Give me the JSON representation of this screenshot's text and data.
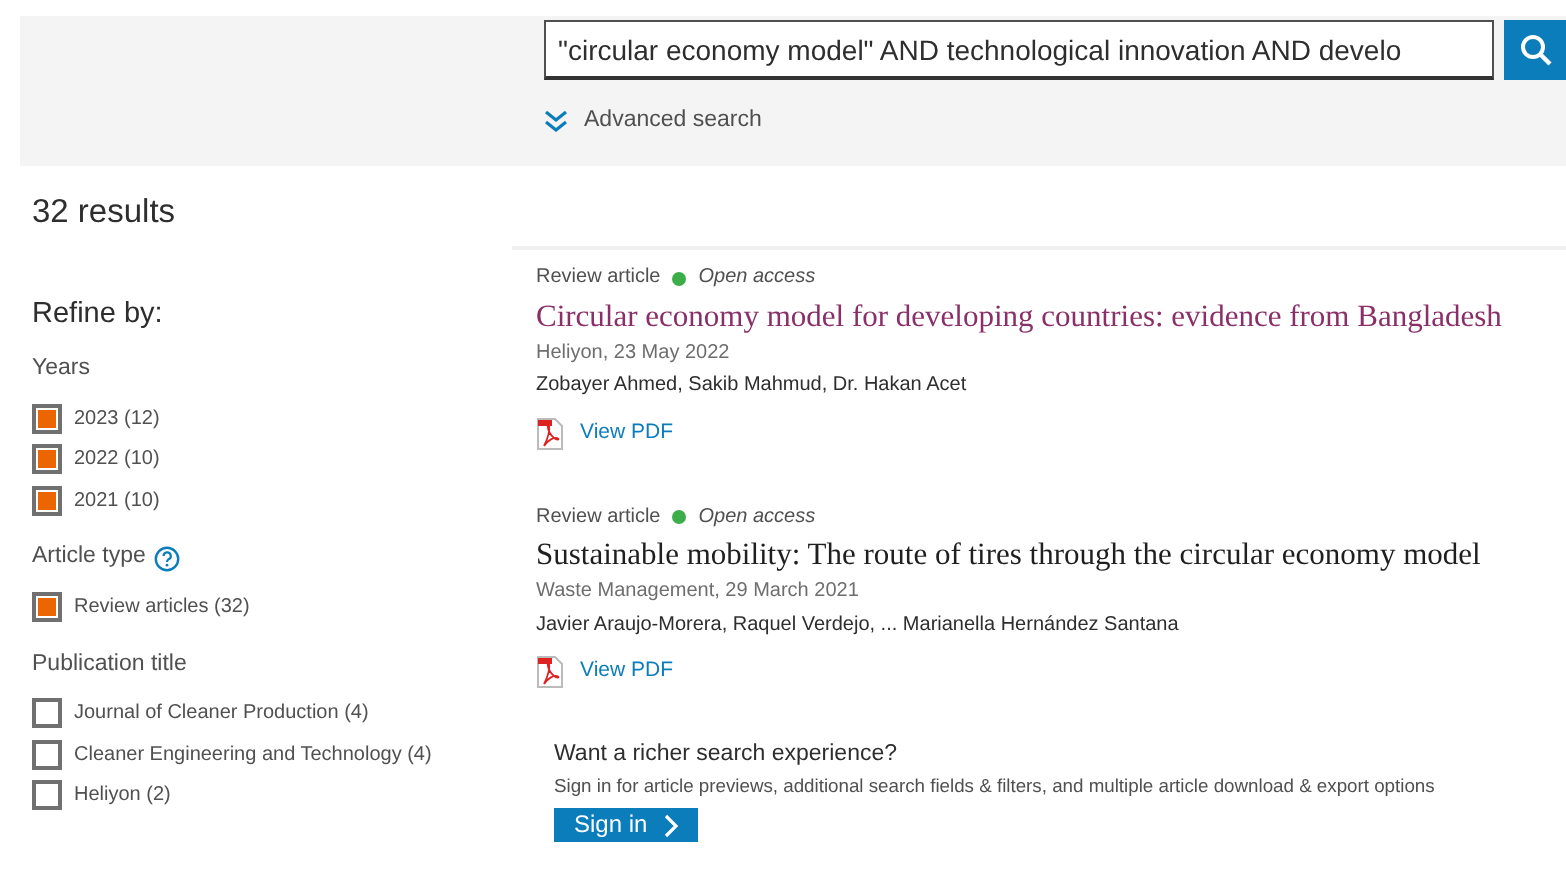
{
  "search": {
    "value": "\"circular economy model\" AND technological innovation AND develo",
    "advanced_label": "Advanced search"
  },
  "results_count": "32 results",
  "refine": {
    "title": "Refine by:",
    "groups": [
      {
        "title": "Years",
        "help": false,
        "options": [
          {
            "label": "2023 (12)",
            "checked": true
          },
          {
            "label": "2022 (10)",
            "checked": true
          },
          {
            "label": "2021 (10)",
            "checked": true
          }
        ]
      },
      {
        "title": "Article type",
        "help": true,
        "options": [
          {
            "label": "Review articles (32)",
            "checked": true
          }
        ]
      },
      {
        "title": "Publication title",
        "help": false,
        "options": [
          {
            "label": "Journal of Cleaner Production (4)",
            "checked": false
          },
          {
            "label": "Cleaner Engineering and Technology (4)",
            "checked": false
          },
          {
            "label": "Heliyon (2)",
            "checked": false
          }
        ]
      }
    ]
  },
  "results": [
    {
      "type": "Review article",
      "access": "Open access",
      "title": "Circular economy model for developing countries: evidence from Bangladesh",
      "visited": true,
      "source": "Heliyon, 23 May 2022",
      "authors": "Zobayer Ahmed, Sakib Mahmud, Dr. Hakan Acet",
      "pdf": "View PDF"
    },
    {
      "type": "Review article",
      "access": "Open access",
      "title": "Sustainable mobility: The route of tires through the circular economy model",
      "visited": false,
      "source": "Waste Management, 29 March 2021",
      "authors": "Javier Araujo-Morera, Raquel Verdejo, ... Marianella Hernández Santana",
      "pdf": "View PDF"
    }
  ],
  "promo": {
    "heading": "Want a richer search experience?",
    "text": "Sign in for article previews, additional search fields & filters, and multiple article download & export options",
    "button": "Sign in"
  }
}
